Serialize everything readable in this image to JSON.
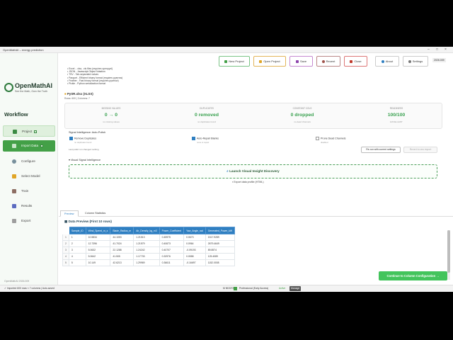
{
  "window_title": "OpenMathAI – energy prediction",
  "brand": {
    "name": "OpenMathAI",
    "tagline": "See the Math, Own the Truth"
  },
  "sidebar": {
    "heading": "Workflow",
    "items": [
      {
        "label": "Project",
        "state": "active"
      },
      {
        "label": "Import Data",
        "state": "current"
      },
      {
        "label": "Configure",
        "state": ""
      },
      {
        "label": "Select Model",
        "state": ""
      },
      {
        "label": "Train",
        "state": ""
      },
      {
        "label": "Results",
        "state": ""
      },
      {
        "label": "Export",
        "state": ""
      }
    ],
    "footer": "OpenMathAI 2026.009"
  },
  "toolbar": {
    "new_project": "New Project",
    "open_project": "Open Project",
    "save": "Save",
    "recent": "Recent",
    "close": "Close",
    "about": "About",
    "settings": "Settings",
    "version_badge": "2026.009"
  },
  "formats": [
    "• Excel - .xlsx, .xls files (requires openpyxl)",
    "• JSON - Javascript Object Notation",
    "• TSV - Tab-separated values",
    "• Parquet - Efficient binary format (requires pyarrow)",
    "• Feather - Fast binary format (requires pyarrow)",
    "• Pickle - Python serialization format"
  ],
  "file": {
    "name": "PySR.xlsx (XLSX)",
    "meta": "Rows: 600 | Columns: 7"
  },
  "stats": [
    {
      "label": "MISSING VALUES",
      "value": "0 → 0",
      "sub": "no missing values"
    },
    {
      "label": "DUPLICATES",
      "value": "0 removed",
      "sub": "no duplicates found"
    },
    {
      "label": "CONSTANT COLS",
      "value": "0 dropped",
      "sub": "no dead channels"
    },
    {
      "label": "READINESS",
      "value": "100/100",
      "sub": "EXCELLENT"
    }
  ],
  "signal": {
    "title": "Signal Intelligence: Auto-Polish",
    "toggles": [
      {
        "label": "Remove Duplicates",
        "desc": "no duplicates found",
        "on": true
      },
      {
        "label": "Auto-Repair Blanks",
        "desc": "none to repair",
        "on": true
      },
      {
        "label": "Prune Dead Channels",
        "desc": "disabled",
        "on": false
      }
    ],
    "last_run": "Last polish run changed nothing",
    "rerun": "Re-run with current settings",
    "revert": "Revert to raw import"
  },
  "visual": {
    "title": "Visual Signal Intelligence",
    "launch": "Launch Visual Insight Discovery",
    "export": "Export data profile (HTML)"
  },
  "tabs": [
    "Preview",
    "Column Statistics"
  ],
  "preview": {
    "title": "Data Preview (First 10 rows)",
    "columns": [
      "Sample_ID",
      "Wind_Speed_m_s",
      "Blade_Radius_m",
      "Air_Density_kg_m3",
      "Power_Coefficient",
      "Yaw_Angle_rad",
      "Generated_Power_kW"
    ],
    "rows": [
      [
        "1",
        "1",
        "10.5834",
        "44.1053",
        "1.21513",
        "0.45975",
        "0.0673",
        "1517.9289"
      ],
      [
        "2",
        "2",
        "12.7396",
        "41.7024",
        "1.21579",
        "0.40673",
        "0.0964",
        "2679.4649"
      ],
      [
        "3",
        "3",
        "5.0632",
        "22.1288",
        "1.24242",
        "0.40707",
        "-0.09193",
        "89.8574"
      ],
      [
        "4",
        "4",
        "5.0642",
        "41.505",
        "1.17733",
        "0.32976",
        "0.0558",
        "125.4089"
      ],
      [
        "5",
        "5",
        "10.149",
        "42.6213",
        "1.29969",
        "0.36611",
        "-0.16697",
        "1152.0008"
      ]
    ]
  },
  "continue": "Continue to Column Configuration →",
  "status": {
    "left": "✓ Imported 600 rows × 7 columns | Auto-saved",
    "mid": "M NEATON",
    "license": "Professional (Early Access)",
    "active": "Active",
    "manage": "Manage"
  }
}
